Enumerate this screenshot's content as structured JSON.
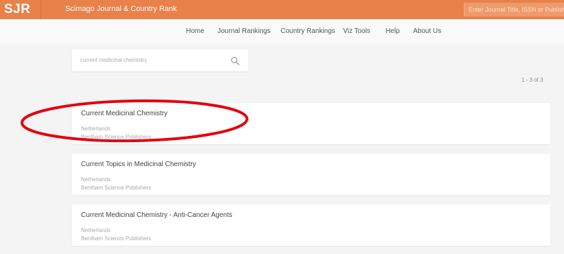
{
  "header": {
    "logo": "SJR",
    "site_title": "Scimago Journal & Country Rank",
    "search_placeholder": "Enter Journal Title, ISSN or Publisher N"
  },
  "nav": {
    "items": [
      "Home",
      "Journal Rankings",
      "Country Rankings",
      "Viz Tools",
      "Help",
      "About Us"
    ]
  },
  "search": {
    "value": "current medicinal chemistry",
    "icon": "search-icon"
  },
  "results": {
    "count_text": "1 - 3 of 3",
    "items": [
      {
        "title": "Current Medicinal Chemistry",
        "country": "Netherlands",
        "publisher": "Bentham Science Publishers"
      },
      {
        "title": "Current Topics in Medicinal Chemistry",
        "country": "Netherlands",
        "publisher": "Bentham Science Publishers"
      },
      {
        "title": "Current Medicinal Chemistry - Anti-Cancer Agents",
        "country": "Netherlands",
        "publisher": "Bentham Science Publishers"
      }
    ]
  },
  "colors": {
    "brand": "#e8814a",
    "annotation": "#e3000f"
  }
}
